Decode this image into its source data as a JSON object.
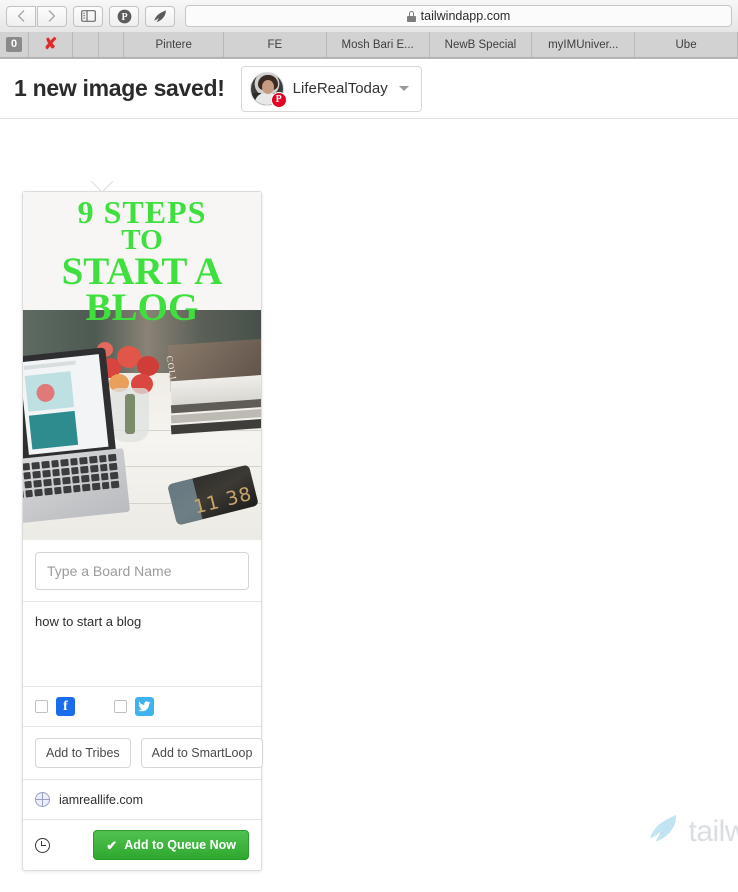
{
  "browser": {
    "back_icon": "chevron-left-icon",
    "forward_icon": "chevron-right-icon",
    "sidebar_icon": "sidebar-icon",
    "pinterest_icon": "pinterest-icon",
    "tailwind_icon": "tailwind-flame-icon",
    "url": "tailwindapp.com",
    "lock_icon": "lock-icon"
  },
  "tabstrip": {
    "badge_count": "0",
    "close_icon": "red-x-icon",
    "tabs": [
      {
        "label": "Pintere"
      },
      {
        "label": "FE"
      },
      {
        "label": "Mosh Bari E..."
      },
      {
        "label": "NewB Special"
      },
      {
        "label": "myIMUniver..."
      },
      {
        "label": "Ube"
      }
    ]
  },
  "header": {
    "title": "1 new image saved!",
    "account": {
      "name": "LifeRealToday",
      "avatar_name": "avatar",
      "badge_icon": "pinterest-badge-icon",
      "badge_glyph": "P",
      "chevron_icon": "chevron-down-icon"
    }
  },
  "pin_card": {
    "image": {
      "overlay_lines": [
        "9 STEPS",
        "TO",
        "START A",
        "BLOG"
      ],
      "overlay_color": "#3ee03e",
      "phone_time": "11 38",
      "magazine_text": "COLLECTION"
    },
    "board_input": {
      "placeholder": "Type a Board Name",
      "value": ""
    },
    "description": "how to start a blog",
    "social": [
      {
        "name": "facebook",
        "glyph": "f",
        "color": "#1b6ced",
        "checked": false
      },
      {
        "name": "twitter",
        "glyph": "twitter-bird",
        "color": "#3fb3f0",
        "checked": false
      }
    ],
    "buttons": {
      "tribes": "Add to Tribes",
      "smartloop": "Add to SmartLoop"
    },
    "source": {
      "icon": "globe-icon",
      "text": "iamreallife.com"
    },
    "queue": {
      "schedule_icon": "clock-icon",
      "check_icon": "check-icon",
      "label": "Add to Queue Now",
      "color": "#2fa82f"
    }
  },
  "watermark": {
    "icon": "tailwind-flame-icon",
    "text": "tailw"
  }
}
